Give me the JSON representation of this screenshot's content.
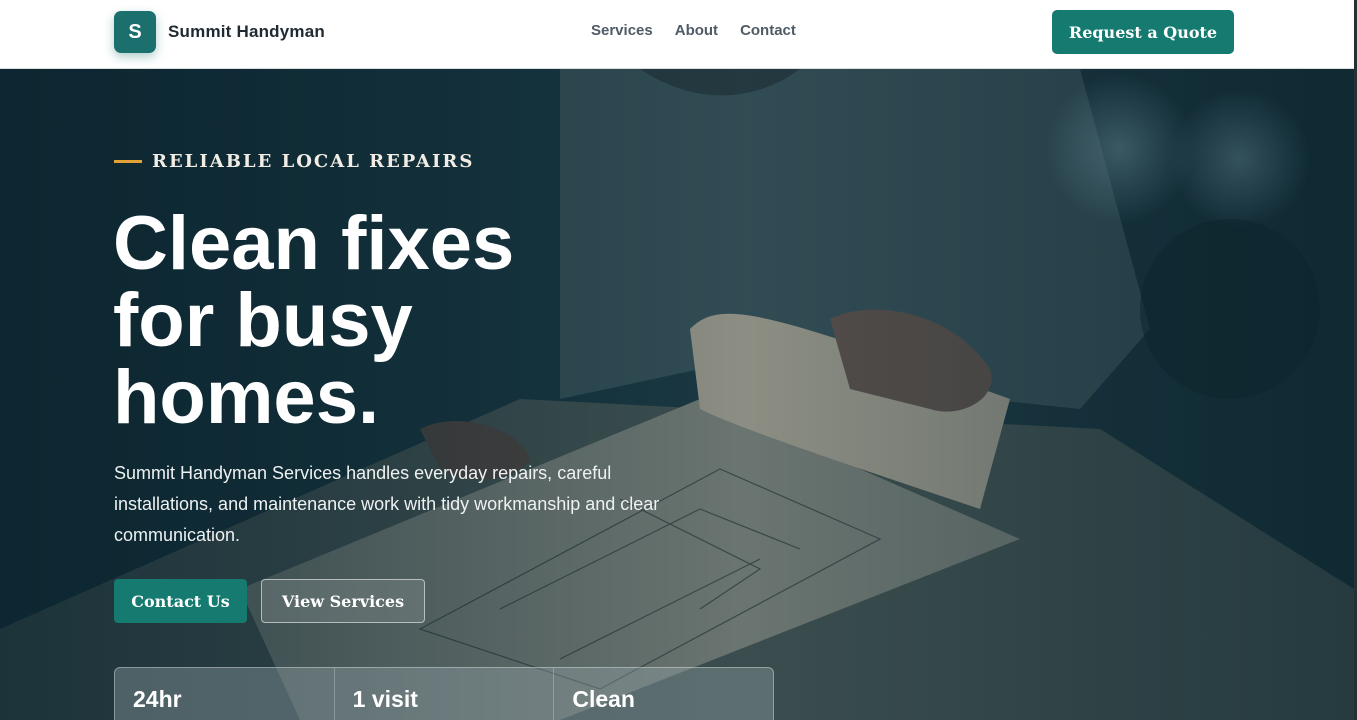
{
  "header": {
    "logo_letter": "S",
    "brand_name": "Summit Handyman",
    "nav": [
      {
        "label": "Services"
      },
      {
        "label": "About"
      },
      {
        "label": "Contact"
      }
    ],
    "cta_label": "Request a Quote"
  },
  "hero": {
    "eyebrow": "RELIABLE LOCAL REPAIRS",
    "headline_lines": [
      "Clean fixes",
      "for busy",
      "homes."
    ],
    "description": "Summit Handyman Services handles everyday repairs, careful installations, and maintenance work with tidy workmanship and clear communication.",
    "primary_button": "Contact Us",
    "secondary_button": "View Services",
    "stats": [
      {
        "label": "24hr"
      },
      {
        "label": "1 visit"
      },
      {
        "label": "Clean"
      }
    ]
  },
  "colors": {
    "accent": "#157a70",
    "eyebrow_line": "#e2a233",
    "hero_overlay": "#0f2a33"
  }
}
